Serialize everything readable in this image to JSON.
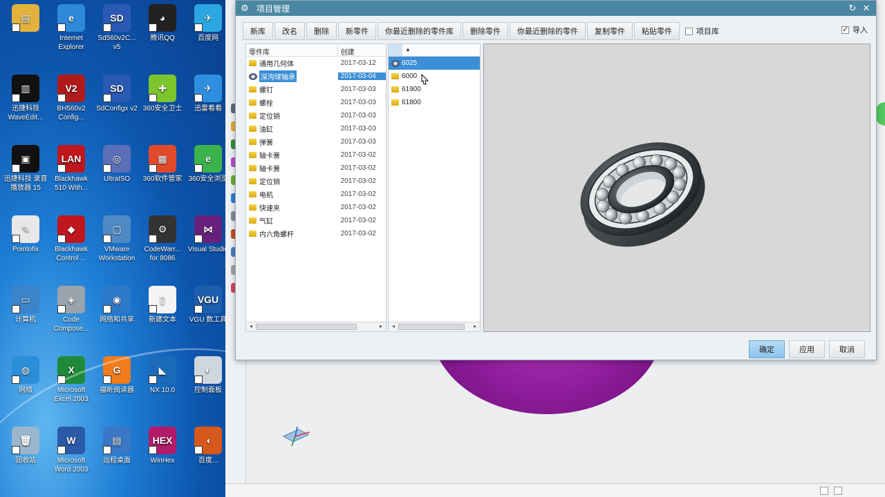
{
  "desktop": {
    "icons": [
      {
        "label": "",
        "color": "#e3b23c",
        "glyph": "▤"
      },
      {
        "label": "Internet Explorer",
        "color": "#2c8ad8",
        "glyph": "e"
      },
      {
        "label": "Sd560v2C... v5",
        "color": "#2a5ab4",
        "glyph": "SD"
      },
      {
        "label": "腾讯QQ",
        "color": "#222222",
        "glyph": "◕"
      },
      {
        "label": "百度网",
        "color": "#2aa7e0",
        "glyph": "✈"
      },
      {
        "label": "迅捷科技 WaveEdit...",
        "color": "#111111",
        "glyph": "▥"
      },
      {
        "label": "BH560v2 Config...",
        "color": "#b01a1a",
        "glyph": "V2"
      },
      {
        "label": "SdConfigx v2",
        "color": "#2a5ab4",
        "glyph": "SD"
      },
      {
        "label": "360安全卫士",
        "color": "#7cc52c",
        "glyph": "✚"
      },
      {
        "label": "迅雷看看",
        "color": "#2d8fe0",
        "glyph": "✈"
      },
      {
        "label": "迅捷科技 录音播放器 15",
        "color": "#111111",
        "glyph": "▣"
      },
      {
        "label": "Blackhawk 510 With...",
        "color": "#c0161d",
        "glyph": "LAN"
      },
      {
        "label": "UltraISO",
        "color": "#5a6fb8",
        "glyph": "◎"
      },
      {
        "label": "360软件管家",
        "color": "#e04a2a",
        "glyph": "▦"
      },
      {
        "label": "360安全浏览",
        "color": "#3cb34a",
        "glyph": "e"
      },
      {
        "label": "Pointofix",
        "color": "#e8e8e8",
        "glyph": "✎"
      },
      {
        "label": "Blackhawk Control ...",
        "color": "#c0161d",
        "glyph": "◆"
      },
      {
        "label": "VMware Workstation",
        "color": "#4f8ac4",
        "glyph": "▢"
      },
      {
        "label": "CodeWarr... for 8086",
        "color": "#333333",
        "glyph": "⚙"
      },
      {
        "label": "Visual Studio",
        "color": "#68217a",
        "glyph": "⋈"
      },
      {
        "label": "计算机",
        "color": "#3b84c9",
        "glyph": "▭"
      },
      {
        "label": "Code Compose...",
        "color": "#9aa4ad",
        "glyph": "◈"
      },
      {
        "label": "网络和共享",
        "color": "#2d78c8",
        "glyph": "◉"
      },
      {
        "label": "新建文本",
        "color": "#f4f4f4",
        "glyph": "▯"
      },
      {
        "label": "VGU 数工具",
        "color": "#1d5fae",
        "glyph": "VGU"
      },
      {
        "label": "网络",
        "color": "#2a8fd8",
        "glyph": "◍"
      },
      {
        "label": "Microsoft Excel 2003",
        "color": "#1f8a3a",
        "glyph": "X"
      },
      {
        "label": "福昕阅读器",
        "color": "#f07c1c",
        "glyph": "G"
      },
      {
        "label": "NX 10.0",
        "color": "#1b6bb8",
        "glyph": "◣"
      },
      {
        "label": "控制面板",
        "color": "#cfd6de",
        "glyph": "◐"
      },
      {
        "label": "回收站",
        "color": "#9ab6cf",
        "glyph": "🗑"
      },
      {
        "label": "Microsoft Word 2003",
        "color": "#2a5aa8",
        "glyph": "W"
      },
      {
        "label": "远程桌面",
        "color": "#3a77c4",
        "glyph": "▤"
      },
      {
        "label": "WinHex",
        "color": "#b21a6a",
        "glyph": "HEX"
      },
      {
        "label": "百度...",
        "color": "#d6581a",
        "glyph": "◖"
      }
    ]
  },
  "dialog": {
    "title": "项目管理",
    "toolbar": [
      "新库",
      "改名",
      "删除",
      "新零件",
      "你最近删除的零件库",
      "删除零件",
      "你最近删除的零件",
      "复制零件",
      "粘贴零件"
    ],
    "project_lib_checkbox": "项目库",
    "import_checkbox": "导入",
    "import_checked": true,
    "project_lib_checked": false,
    "library_columns": [
      "零件库",
      "创建"
    ],
    "libraries": [
      {
        "name": "通用几何体",
        "date": "2017-03-12",
        "selected": false
      },
      {
        "name": "深沟球轴承",
        "date": "2017-03-04",
        "selected": true
      },
      {
        "name": "螺钉",
        "date": "2017-03-03",
        "selected": false
      },
      {
        "name": "螺栓",
        "date": "2017-03-03",
        "selected": false
      },
      {
        "name": "定位销",
        "date": "2017-03-03",
        "selected": false
      },
      {
        "name": "油缸",
        "date": "2017-03-03",
        "selected": false
      },
      {
        "name": "弹簧",
        "date": "2017-03-03",
        "selected": false
      },
      {
        "name": "轴卡簧",
        "date": "2017-03-02",
        "selected": false
      },
      {
        "name": "轴卡簧",
        "date": "2017-03-02",
        "selected": false
      },
      {
        "name": "定位销",
        "date": "2017-03-02",
        "selected": false
      },
      {
        "name": "电机",
        "date": "2017-03-02",
        "selected": false
      },
      {
        "name": "快速夹",
        "date": "2017-03-02",
        "selected": false
      },
      {
        "name": "气缸",
        "date": "2017-03-02",
        "selected": false
      },
      {
        "name": "内六角螺杆",
        "date": "2017-03-02",
        "selected": false
      }
    ],
    "parts": [
      {
        "name": "6025",
        "selected": true
      },
      {
        "name": "6000",
        "selected": false
      },
      {
        "name": "61900",
        "selected": false
      },
      {
        "name": "61800",
        "selected": false
      }
    ],
    "buttons": {
      "ok": "确定",
      "apply": "应用",
      "cancel": "取消"
    }
  }
}
